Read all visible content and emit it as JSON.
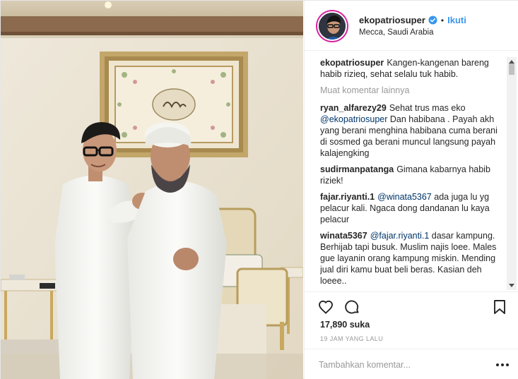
{
  "header": {
    "username": "ekopatriosuper",
    "separator": "•",
    "follow_label": "Ikuti",
    "location": "Mecca, Saudi Arabia"
  },
  "caption": {
    "user": "ekopatriosuper",
    "text": "Kangen-kangenan bareng habib rizieq, sehat selalu tuk habib."
  },
  "load_more_label": "Muat komentar lainnya",
  "comments": [
    {
      "user": "ryan_alfarezy29",
      "parts": [
        {
          "t": "Sehat trus mas eko "
        },
        {
          "t": "@ekopatriosuper",
          "mention": true
        },
        {
          "t": " Dan habibana . Payah akh yang berani menghina habibana cuma berani di sosmed ga berani muncul langsung payah kalajengking"
        }
      ]
    },
    {
      "user": "sudirmanpatanga",
      "parts": [
        {
          "t": "Gimana kabarnya habib riziek!"
        }
      ]
    },
    {
      "user": "fajar.riyanti.1",
      "parts": [
        {
          "t": "@winata5367",
          "mention": true
        },
        {
          "t": " ada juga lu yg pelacur kali. Ngaca dong dandanan lu kaya pelacur"
        }
      ]
    },
    {
      "user": "winata5367",
      "parts": [
        {
          "t": "@fajar.riyanti.1",
          "mention": true
        },
        {
          "t": " dasar kampung. Berhijab tapi busuk. Muslim najis loee. Males gue layanin orang kampung miskin. Mending jual diri kamu buat beli beras. Kasian deh loeee.."
        }
      ]
    }
  ],
  "likes": "17,890 suka",
  "timestamp": "19 JAM YANG LALU",
  "add_comment": {
    "placeholder": "Tambahkan komentar..."
  },
  "colors": {
    "link": "#3897f0",
    "mention": "#003569",
    "muted": "#999999",
    "verified": "#3897f0"
  },
  "icons": [
    "verified-badge-icon",
    "heart-icon",
    "comment-icon",
    "bookmark-icon",
    "more-options-icon"
  ]
}
